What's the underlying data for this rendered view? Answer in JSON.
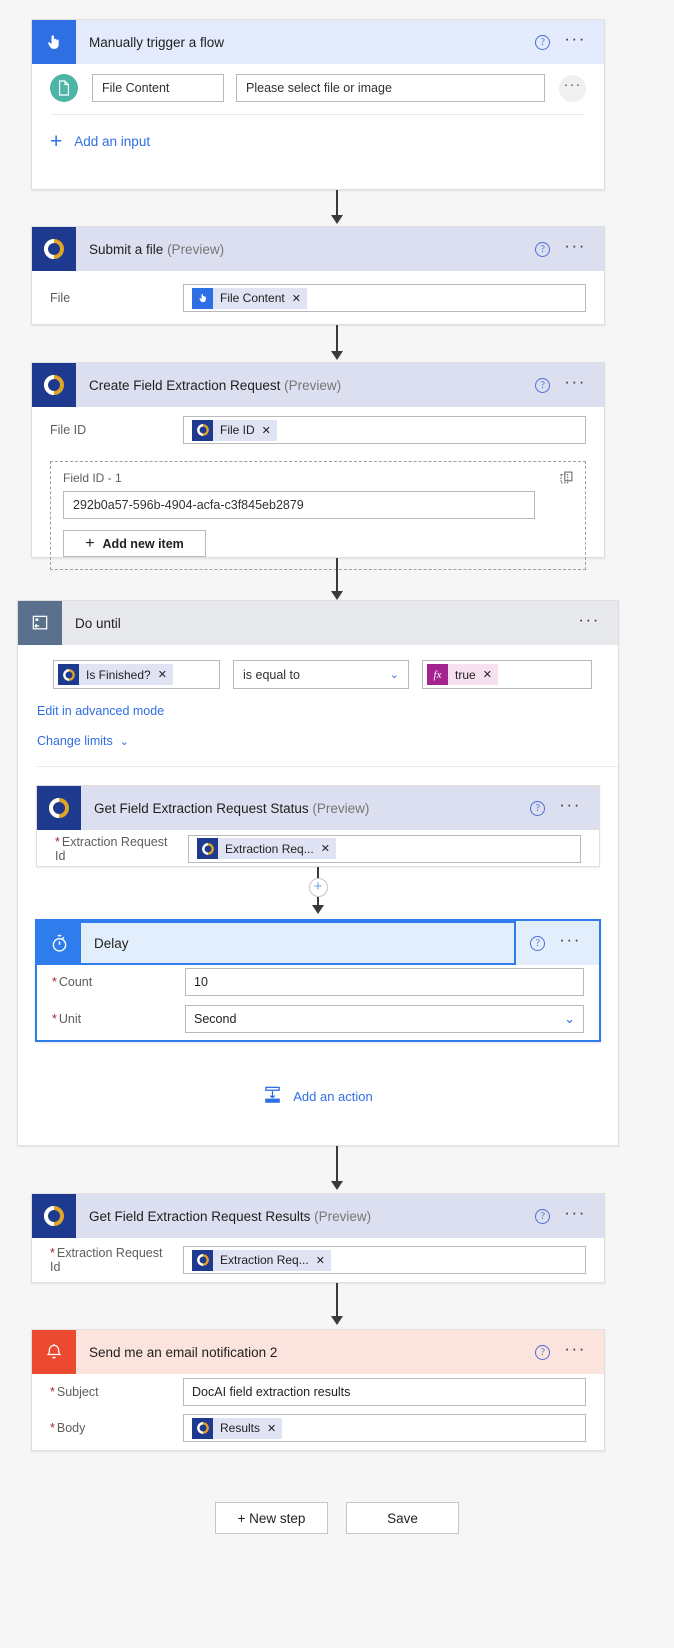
{
  "trigger": {
    "title": "Manually trigger a flow",
    "icon": "hand-pointer-icon",
    "input_name": "File Content",
    "input_placeholder": "Please select file or image",
    "add_input_label": "Add an input",
    "file_icon": "document-icon"
  },
  "submit_file": {
    "title": "Submit a file",
    "preview": "(Preview)",
    "label_file": "File",
    "token": "File Content"
  },
  "create_request": {
    "title": "Create Field Extraction Request",
    "preview": "(Preview)",
    "label_file_id": "File ID",
    "token": "File ID",
    "group_label": "Field ID - 1",
    "group_value": "292b0a57-596b-4904-acfa-c3f845eb2879",
    "add_new_item": "Add new item",
    "copy_icon": "copy-icon"
  },
  "do_until": {
    "title": "Do until",
    "left_token": "Is Finished?",
    "operator": "is equal to",
    "right_token": "true",
    "fx_label": "fx",
    "advanced_link": "Edit in advanced mode",
    "change_limits": "Change limits"
  },
  "get_status": {
    "title": "Get Field Extraction Request Status",
    "preview": "(Preview)",
    "label": "Extraction Request Id",
    "token": "Extraction Req..."
  },
  "delay": {
    "title": "Delay",
    "icon": "stopwatch-icon",
    "label_count": "Count",
    "value_count": "10",
    "label_unit": "Unit",
    "value_unit": "Second"
  },
  "add_action": {
    "label": "Add an action",
    "icon": "insert-action-icon"
  },
  "get_results": {
    "title": "Get Field Extraction Request Results",
    "preview": "(Preview)",
    "label": "Extraction Request Id",
    "token": "Extraction Req..."
  },
  "email": {
    "title": "Send me an email notification 2",
    "icon": "bell-icon",
    "label_subject": "Subject",
    "value_subject": "DocAI field extraction results",
    "label_body": "Body",
    "token_body": "Results"
  },
  "footer": {
    "new_step": "+ New step",
    "save": "Save"
  },
  "icons": {
    "help": "help-circle-icon",
    "more": "more-options-icon",
    "plus": "plus-icon",
    "chevron": "chevron-down-icon",
    "close": "close-icon"
  },
  "colors": {
    "accent": "#2f6fe4",
    "navy": "#1e3a8f",
    "gold": "#e0a526",
    "teal": "#4cb5a5",
    "red": "#eb4a31",
    "magenta": "#a4248f",
    "slate": "#5b708c",
    "required": "#a4262c"
  }
}
